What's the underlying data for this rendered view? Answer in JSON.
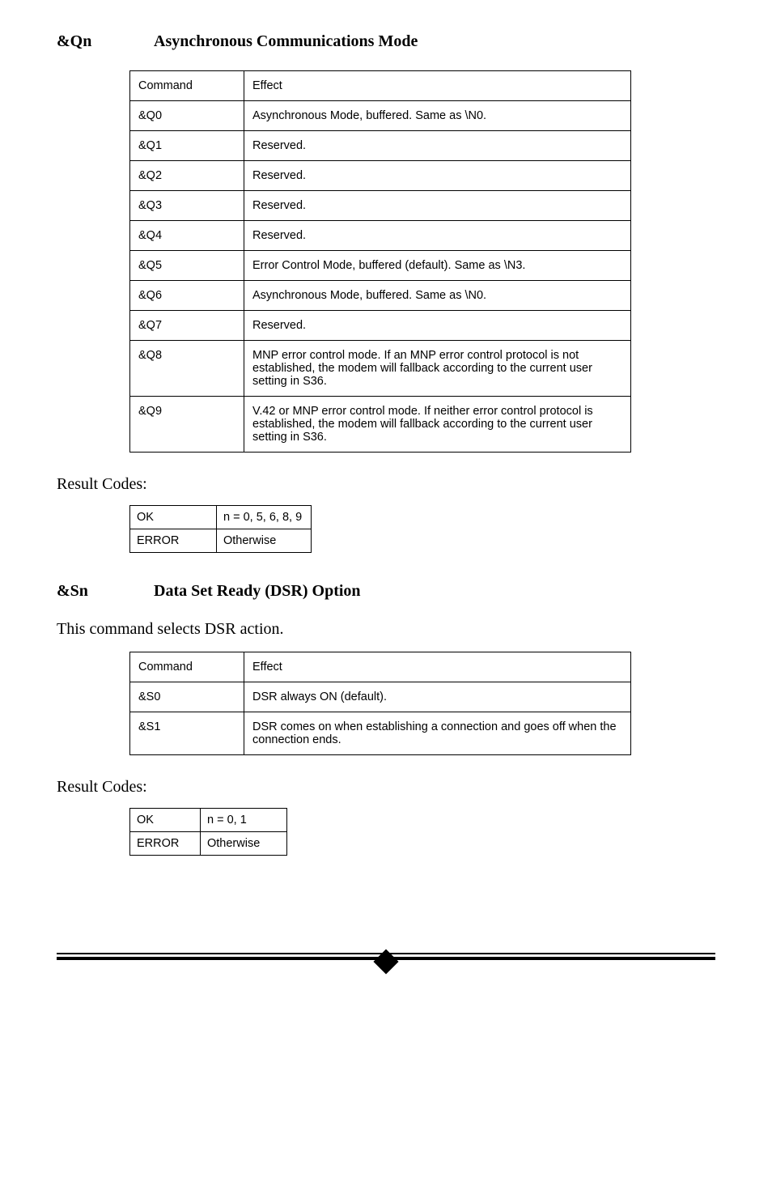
{
  "section1": {
    "cmd": "&Qn",
    "title": "Asynchronous Communications Mode",
    "headers": {
      "c1": "Command",
      "c2": "Effect"
    },
    "rows": [
      {
        "c": "&Q0",
        "e": "Asynchronous Mode, buffered. Same as \\N0."
      },
      {
        "c": "&Q1",
        "e": "Reserved."
      },
      {
        "c": "&Q2",
        "e": "Reserved."
      },
      {
        "c": "&Q3",
        "e": "Reserved."
      },
      {
        "c": "&Q4",
        "e": "Reserved."
      },
      {
        "c": "&Q5",
        "e": "Error Control Mode, buffered (default). Same as \\N3."
      },
      {
        "c": "&Q6",
        "e": "Asynchronous Mode, buffered. Same as \\N0."
      },
      {
        "c": "&Q7",
        "e": "Reserved."
      },
      {
        "c": "&Q8",
        "e": "MNP error control mode. If an MNP error control protocol is not established, the modem will fallback according to the current user setting in S36."
      },
      {
        "c": "&Q9",
        "e": "V.42 or MNP error control mode. If neither error control protocol is established, the modem will fallback according to the current user setting in S36."
      }
    ],
    "result_label": "Result Codes:",
    "result_codes": [
      {
        "c": "OK",
        "e": "n = 0, 5, 6, 8, 9"
      },
      {
        "c": "ERROR",
        "e": "Otherwise"
      }
    ]
  },
  "section2": {
    "cmd": "&Sn",
    "title": "Data Set Ready (DSR) Option",
    "intro": "This command selects DSR action.",
    "headers": {
      "c1": "Command",
      "c2": "Effect"
    },
    "rows": [
      {
        "c": "&S0",
        "e": "DSR always ON (default)."
      },
      {
        "c": "&S1",
        "e": "DSR comes on when establishing a connection and goes off when the connection ends."
      }
    ],
    "result_label": "Result Codes:",
    "result_codes": [
      {
        "c": "OK",
        "e": "n = 0, 1"
      },
      {
        "c": "ERROR",
        "e": "Otherwise"
      }
    ]
  }
}
